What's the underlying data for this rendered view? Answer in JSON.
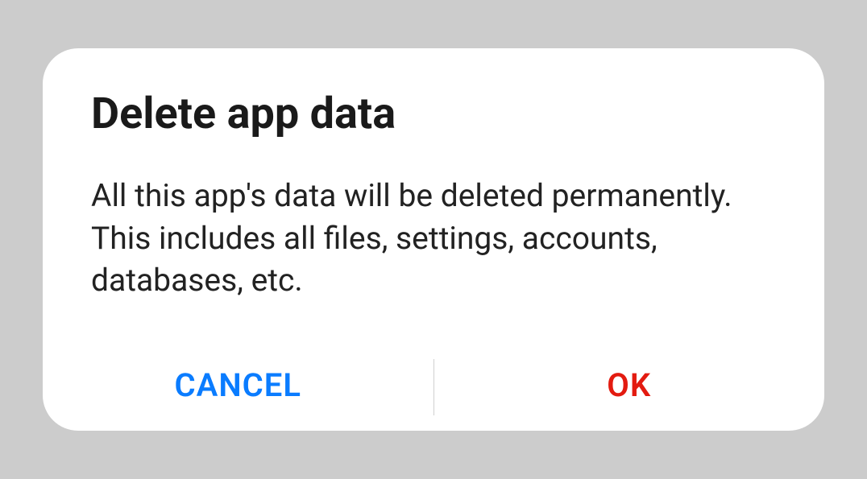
{
  "dialog": {
    "title": "Delete app data",
    "message": "All this app's data will be deleted permanently. This includes all files, settings, accounts, databases, etc.",
    "cancel_label": "CANCEL",
    "ok_label": "OK"
  }
}
